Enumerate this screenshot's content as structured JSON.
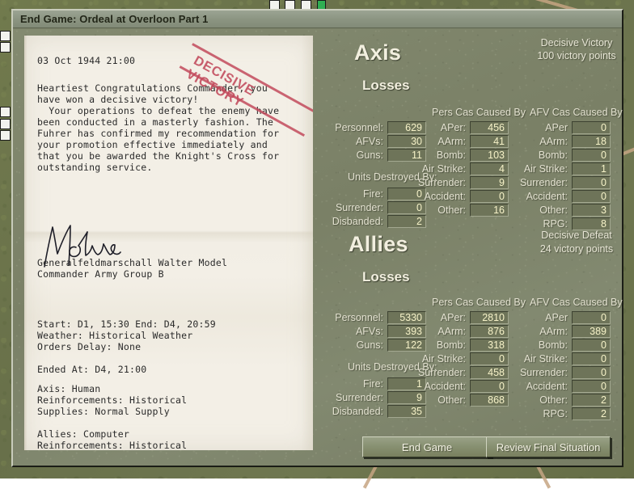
{
  "window": {
    "title": "End Game: Ordeal at Overloon Part 1"
  },
  "letter": {
    "date": "03 Oct 1944 21:00",
    "body": "Heartiest Congratulations Commander, you\nhave won a decisive victory!\n  Your operations to defeat the enemy have\nbeen conducted in a masterly fashion. The\nFuhrer has confirmed my recommendation for\nyour promotion effective immediately and\nthat you be awarded the Knight's Cross for\noutstanding service.",
    "signature_name": "Generalfeldmarschall Walter Model",
    "signature_title": "Commander Army Group B",
    "params": "Start: D1, 15:30 End: D4, 20:59\nWeather: Historical Weather\nOrders Delay: None\n\nEnded At: D4, 21:00",
    "sides": "Axis: Human\nReinforcements: Historical\nSupplies: Normal Supply\n\nAllies: Computer\nReinforcements: Historical\nSupplies: Normal Supply",
    "stamp_text": "DECISIVE VICTORY"
  },
  "axis": {
    "name": "Axis",
    "losses_label": "Losses",
    "verdict": "Decisive Victory",
    "points": "100 victory points",
    "losses": [
      {
        "label": "Personnel:",
        "value": "629"
      },
      {
        "label": "AFVs:",
        "value": "30"
      },
      {
        "label": "Guns:",
        "value": "11"
      }
    ],
    "destroyed_by_label": "Units Destroyed By:",
    "destroyed_by": [
      {
        "label": "Fire:",
        "value": "0"
      },
      {
        "label": "Surrender:",
        "value": "0"
      },
      {
        "label": "Disbanded:",
        "value": "2"
      }
    ],
    "pers_cas_label": "Pers Cas Caused By",
    "pers_cas": [
      {
        "label": "APer:",
        "value": "456"
      },
      {
        "label": "AArm:",
        "value": "41"
      },
      {
        "label": "Bomb:",
        "value": "103"
      },
      {
        "label": "Air Strike:",
        "value": "4"
      },
      {
        "label": "Surrender:",
        "value": "9"
      },
      {
        "label": "Accident:",
        "value": "0"
      },
      {
        "label": "Other:",
        "value": "16"
      }
    ],
    "afv_cas_label": "AFV Cas Caused By",
    "afv_cas": [
      {
        "label": "APer",
        "value": "0"
      },
      {
        "label": "AArm:",
        "value": "18"
      },
      {
        "label": "Bomb:",
        "value": "0"
      },
      {
        "label": "Air Strike:",
        "value": "1"
      },
      {
        "label": "Surrender:",
        "value": "0"
      },
      {
        "label": "Accident:",
        "value": "0"
      },
      {
        "label": "Other:",
        "value": "3"
      },
      {
        "label": "RPG:",
        "value": "8"
      }
    ]
  },
  "allies": {
    "name": "Allies",
    "losses_label": "Losses",
    "verdict": "Decisive Defeat",
    "points": "24 victory points",
    "losses": [
      {
        "label": "Personnel:",
        "value": "5330"
      },
      {
        "label": "AFVs:",
        "value": "393"
      },
      {
        "label": "Guns:",
        "value": "122"
      }
    ],
    "destroyed_by_label": "Units Destroyed By:",
    "destroyed_by": [
      {
        "label": "Fire:",
        "value": "1"
      },
      {
        "label": "Surrender:",
        "value": "9"
      },
      {
        "label": "Disbanded:",
        "value": "35"
      }
    ],
    "pers_cas_label": "Pers Cas Caused By",
    "pers_cas": [
      {
        "label": "APer:",
        "value": "2810"
      },
      {
        "label": "AArm:",
        "value": "876"
      },
      {
        "label": "Bomb:",
        "value": "318"
      },
      {
        "label": "Air Strike:",
        "value": "0"
      },
      {
        "label": "Surrender:",
        "value": "458"
      },
      {
        "label": "Accident:",
        "value": "0"
      },
      {
        "label": "Other:",
        "value": "868"
      }
    ],
    "afv_cas_label": "AFV Cas Caused By",
    "afv_cas": [
      {
        "label": "APer",
        "value": "0"
      },
      {
        "label": "AArm:",
        "value": "389"
      },
      {
        "label": "Bomb:",
        "value": "0"
      },
      {
        "label": "Air Strike:",
        "value": "0"
      },
      {
        "label": "Surrender:",
        "value": "0"
      },
      {
        "label": "Accident:",
        "value": "0"
      },
      {
        "label": "Other:",
        "value": "2"
      },
      {
        "label": "RPG:",
        "value": "2"
      }
    ]
  },
  "buttons": {
    "end_game": "End Game",
    "review": "Review Final Situation"
  },
  "colors": {
    "panel": "#7c8269",
    "title_text": "#f2efdf",
    "value_text": "#f6f2c8",
    "stamp": "#c24a5c"
  }
}
